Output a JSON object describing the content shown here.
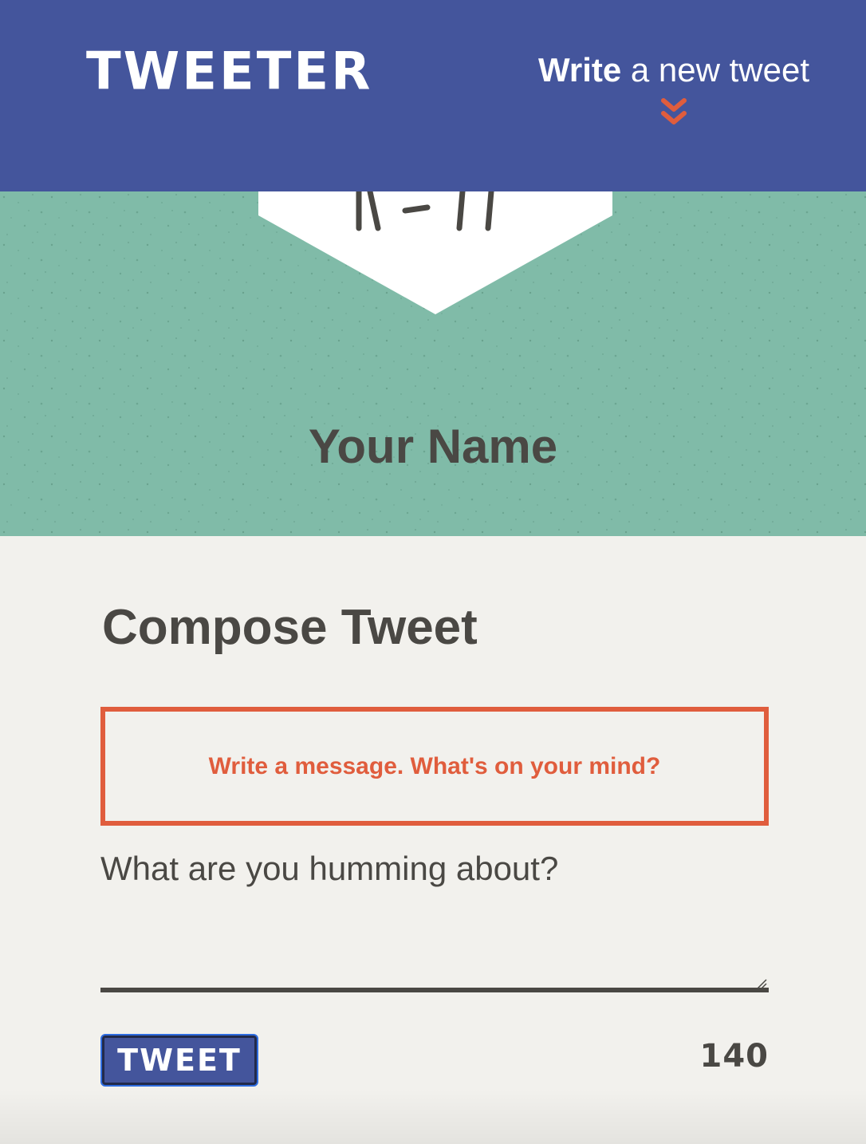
{
  "nav": {
    "logo": "TWEETER",
    "compose_toggle_strong": "Write",
    "compose_toggle_rest": " a new tweet",
    "chevron_icon": "double-chevron-down-icon"
  },
  "profile": {
    "name": "Your Name",
    "background_color": "#80bba8"
  },
  "compose": {
    "title": "Compose Tweet",
    "error_message": "Write a message. What's on your mind?",
    "input_placeholder": "What are you humming about?",
    "input_value": "",
    "tweet_button_label": "TWEET",
    "char_counter": "140"
  },
  "colors": {
    "nav_bg": "#44559c",
    "accent": "#e05d3d",
    "text": "#4a4844",
    "page_bg": "#f2f1ed"
  }
}
